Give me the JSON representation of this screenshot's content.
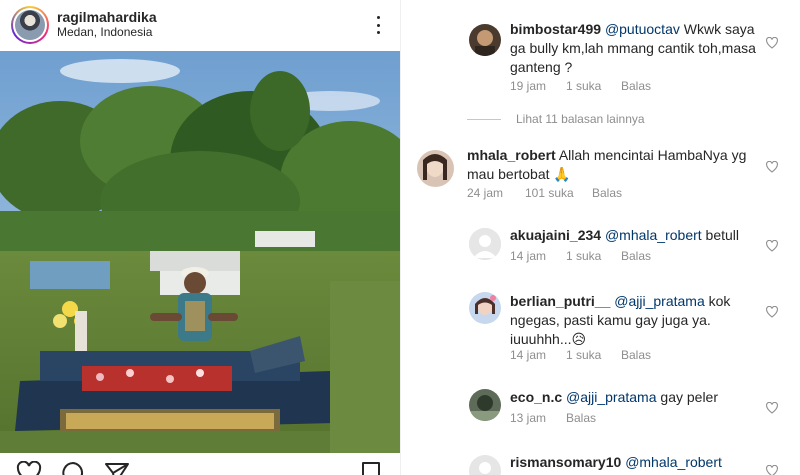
{
  "post": {
    "username": "ragilmahardika",
    "location": "Medan, Indonesia"
  },
  "comments": [
    {
      "username": "bimbostar499",
      "mention": "@putuoctav",
      "text": " Wkwk saya ga bully km,lah mmang cantik toh,masa ganteng ?",
      "time": "19 jam",
      "likes": "1 suka",
      "reply": "Balas"
    },
    {
      "username": "mhala_robert",
      "mention": "",
      "text": " Allah mencintai HambaNya yg mau bertobat 🙏",
      "time": "24 jam",
      "likes": "101 suka",
      "reply": "Balas"
    },
    {
      "username": "akuajaini_234",
      "mention": "@mhala_robert",
      "text": " betull",
      "time": "14 jam",
      "likes": "1 suka",
      "reply": "Balas"
    },
    {
      "username": "berlian_putri__",
      "mention": "@ajji_pratama",
      "text": " kok ngegas, pasti kamu gay juga ya. iuuuhhh...😥",
      "time": "14 jam",
      "likes": "1 suka",
      "reply": "Balas"
    },
    {
      "username": "eco_n.c",
      "mention": "@ajji_pratama",
      "text": " gay peler",
      "time": "13 jam",
      "likes": "",
      "reply": "Balas"
    },
    {
      "username": "rismansomary10",
      "mention": "@mhala_robert",
      "text": "",
      "time": "",
      "likes": "",
      "reply": ""
    }
  ],
  "view_replies": "Lihat 11 balasan lainnya",
  "icons": {
    "more": "more-options-icon",
    "heart": "heart-icon",
    "comment": "comment-icon",
    "share": "share-icon",
    "bookmark": "bookmark-icon"
  },
  "colors": {
    "text": "#262626",
    "meta": "#8e8e8e",
    "mention": "#00376b",
    "divider": "#efefef"
  }
}
